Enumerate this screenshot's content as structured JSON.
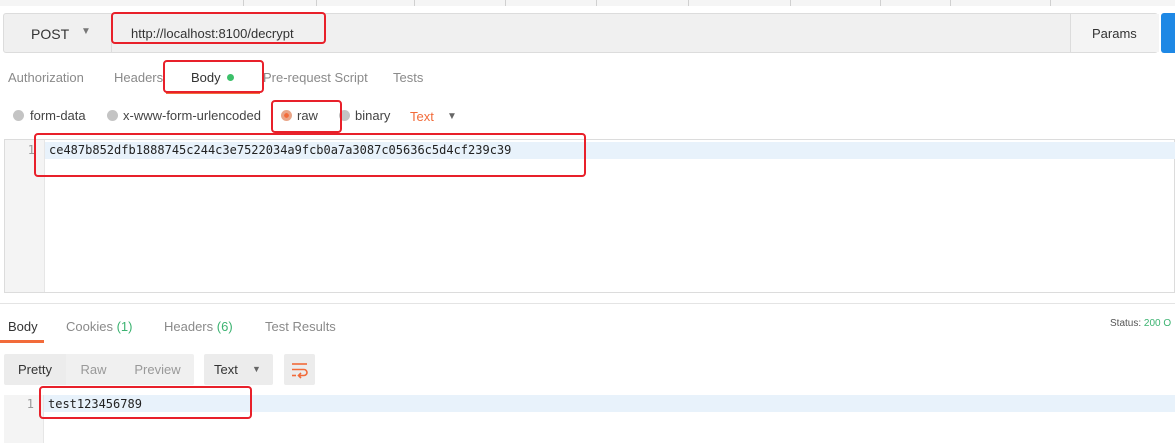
{
  "request": {
    "method": "POST",
    "url": "http://localhost:8100/decrypt",
    "params_label": "Params",
    "tabs": [
      {
        "label": "Authorization"
      },
      {
        "label": "Headers"
      },
      {
        "label": "Body"
      },
      {
        "label": "Pre-request Script"
      },
      {
        "label": "Tests"
      }
    ],
    "body_options": [
      {
        "label": "form-data",
        "selected": false
      },
      {
        "label": "x-www-form-urlencoded",
        "selected": false
      },
      {
        "label": "raw",
        "selected": true
      },
      {
        "label": "binary",
        "selected": false
      }
    ],
    "body_type": "Text",
    "body_line_number": "1",
    "body_content": "ce487b852dfb1888745c244c3e7522034a9fcb0a7a3087c05636c5d4cf239c39"
  },
  "response": {
    "tabs": [
      {
        "label": "Body"
      },
      {
        "label": "Cookies",
        "count": "(1)"
      },
      {
        "label": "Headers",
        "count": "(6)"
      },
      {
        "label": "Test Results"
      }
    ],
    "status_label": "Status:",
    "status_value": "200 O",
    "view_modes": [
      "Pretty",
      "Raw",
      "Preview"
    ],
    "format": "Text",
    "line_number": "1",
    "content": "test123456789"
  },
  "colors": {
    "accent": "#f26b3a",
    "success": "#3cb371",
    "highlight_box": "#e8202a",
    "send_button": "#1e88e5"
  }
}
